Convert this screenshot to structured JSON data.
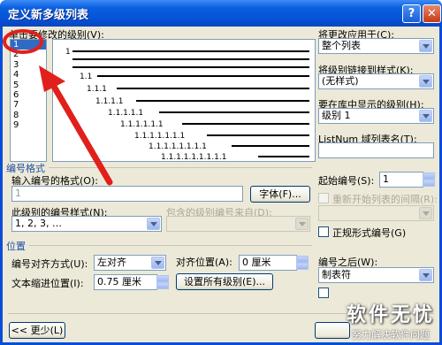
{
  "window": {
    "title": "定义新多级列表",
    "help_glyph": "?",
    "close_glyph": "✕"
  },
  "levels": {
    "label": "单击要修改的级别(V):",
    "items": [
      "1",
      "2",
      "3",
      "4",
      "5",
      "6",
      "7",
      "8",
      "9"
    ],
    "selected": "1"
  },
  "preview": {
    "lines": [
      "1",
      "1.1",
      "1.1.1",
      "1.1.1.1",
      "1.1.1.1.1",
      "1.1.1.1.1.1",
      "1.1.1.1.1.1.1",
      "1.1.1.1.1.1.1.1",
      "1.1.1.1.1.1.1.1.1"
    ]
  },
  "right_panel": {
    "apply_to_label": "将更改应用于(C):",
    "apply_to_value": "整个列表",
    "link_style_label": "将级别链接到样式(K):",
    "link_style_value": "(无样式)",
    "gallery_level_label": "要在库中显示的级别(H):",
    "gallery_level_value": "级别 1",
    "listnum_label": "ListNum 域列表名(T):",
    "listnum_value": ""
  },
  "number_format": {
    "group_label": "编号格式",
    "enter_format_label": "输入编号的格式(O):",
    "format_value": "1",
    "font_button": "字体(F)...",
    "style_label": "此级别的编号样式(N):",
    "style_value": "1, 2, 3, …",
    "include_from_label": "包含的级别编号来自(D):",
    "start_at_label": "起始编号(S):",
    "start_at_value": "1",
    "restart_label": "重新开始列表的间隔(R):",
    "legal_label": "正规形式编号(G)"
  },
  "position": {
    "group_label": "位置",
    "alignment_label": "编号对齐方式(U):",
    "alignment_value": "左对齐",
    "aligned_at_label": "对齐位置(A):",
    "aligned_at_value": "0 厘米",
    "indent_label": "文本缩进位置(I):",
    "indent_value": "0.75 厘米",
    "set_all_button": "设置所有级别(E)...",
    "follow_label": "编号之后(W):",
    "follow_value": "制表符"
  },
  "footer": {
    "less_button": "<< 更少(L)"
  },
  "watermark": {
    "line1": "软件无忧",
    "line2": "努力解决软件问题"
  },
  "colors": {
    "title_bar": "#0a5fe0",
    "dialog_face": "#ece9d8",
    "selection": "#316ac5",
    "annotation_red": "#e0201b"
  }
}
